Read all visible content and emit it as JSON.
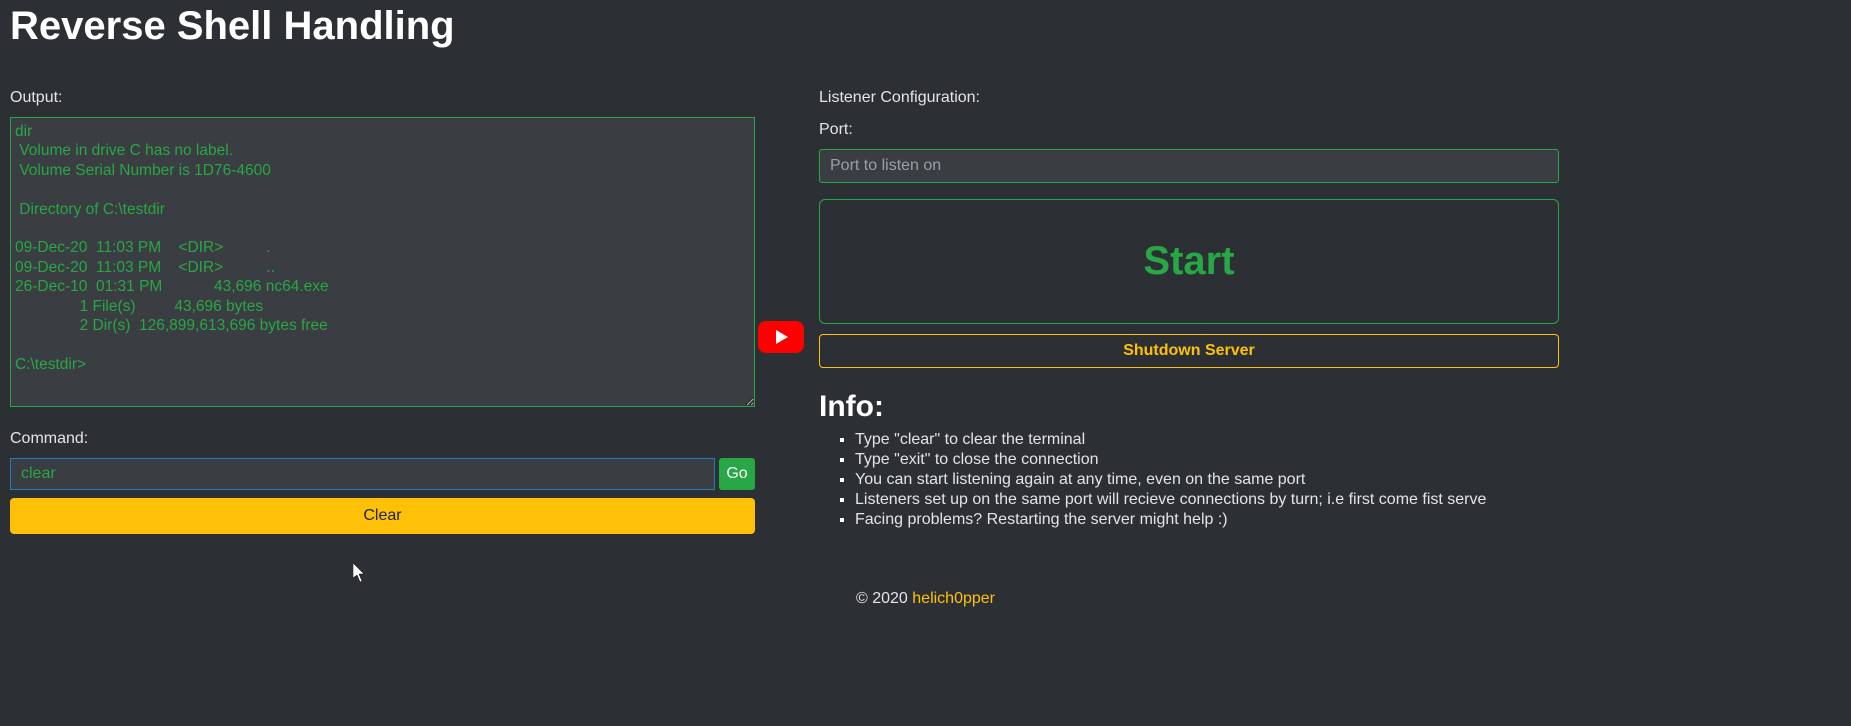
{
  "title": "Reverse Shell Handling",
  "output": {
    "label": "Output:",
    "text": "dir\n Volume in drive C has no label.\n Volume Serial Number is 1D76-4600\n\n Directory of C:\\testdir\n\n09-Dec-20  11:03 PM    <DIR>          .\n09-Dec-20  11:03 PM    <DIR>          ..\n26-Dec-10  01:31 PM            43,696 nc64.exe\n               1 File(s)         43,696 bytes\n               2 Dir(s)  126,899,613,696 bytes free\n\nC:\\testdir>"
  },
  "command": {
    "label": "Command:",
    "value": "clear",
    "go_label": "Go",
    "clear_label": "Clear"
  },
  "listener": {
    "heading": "Listener Configuration:",
    "port_label": "Port:",
    "port_placeholder": "Port to listen on",
    "start_label": "Start",
    "shutdown_label": "Shutdown Server"
  },
  "info": {
    "heading": "Info:",
    "items": [
      "Type \"clear\" to clear the terminal",
      "Type \"exit\" to close the connection",
      "You can start listening again at any time, even on the same port",
      "Listeners set up on the same port will recieve connections by turn; i.e first come fist serve",
      "Facing problems? Restarting the server might help :)"
    ]
  },
  "footer": {
    "copyright": "© 2020 ",
    "author": "helich0pper"
  }
}
